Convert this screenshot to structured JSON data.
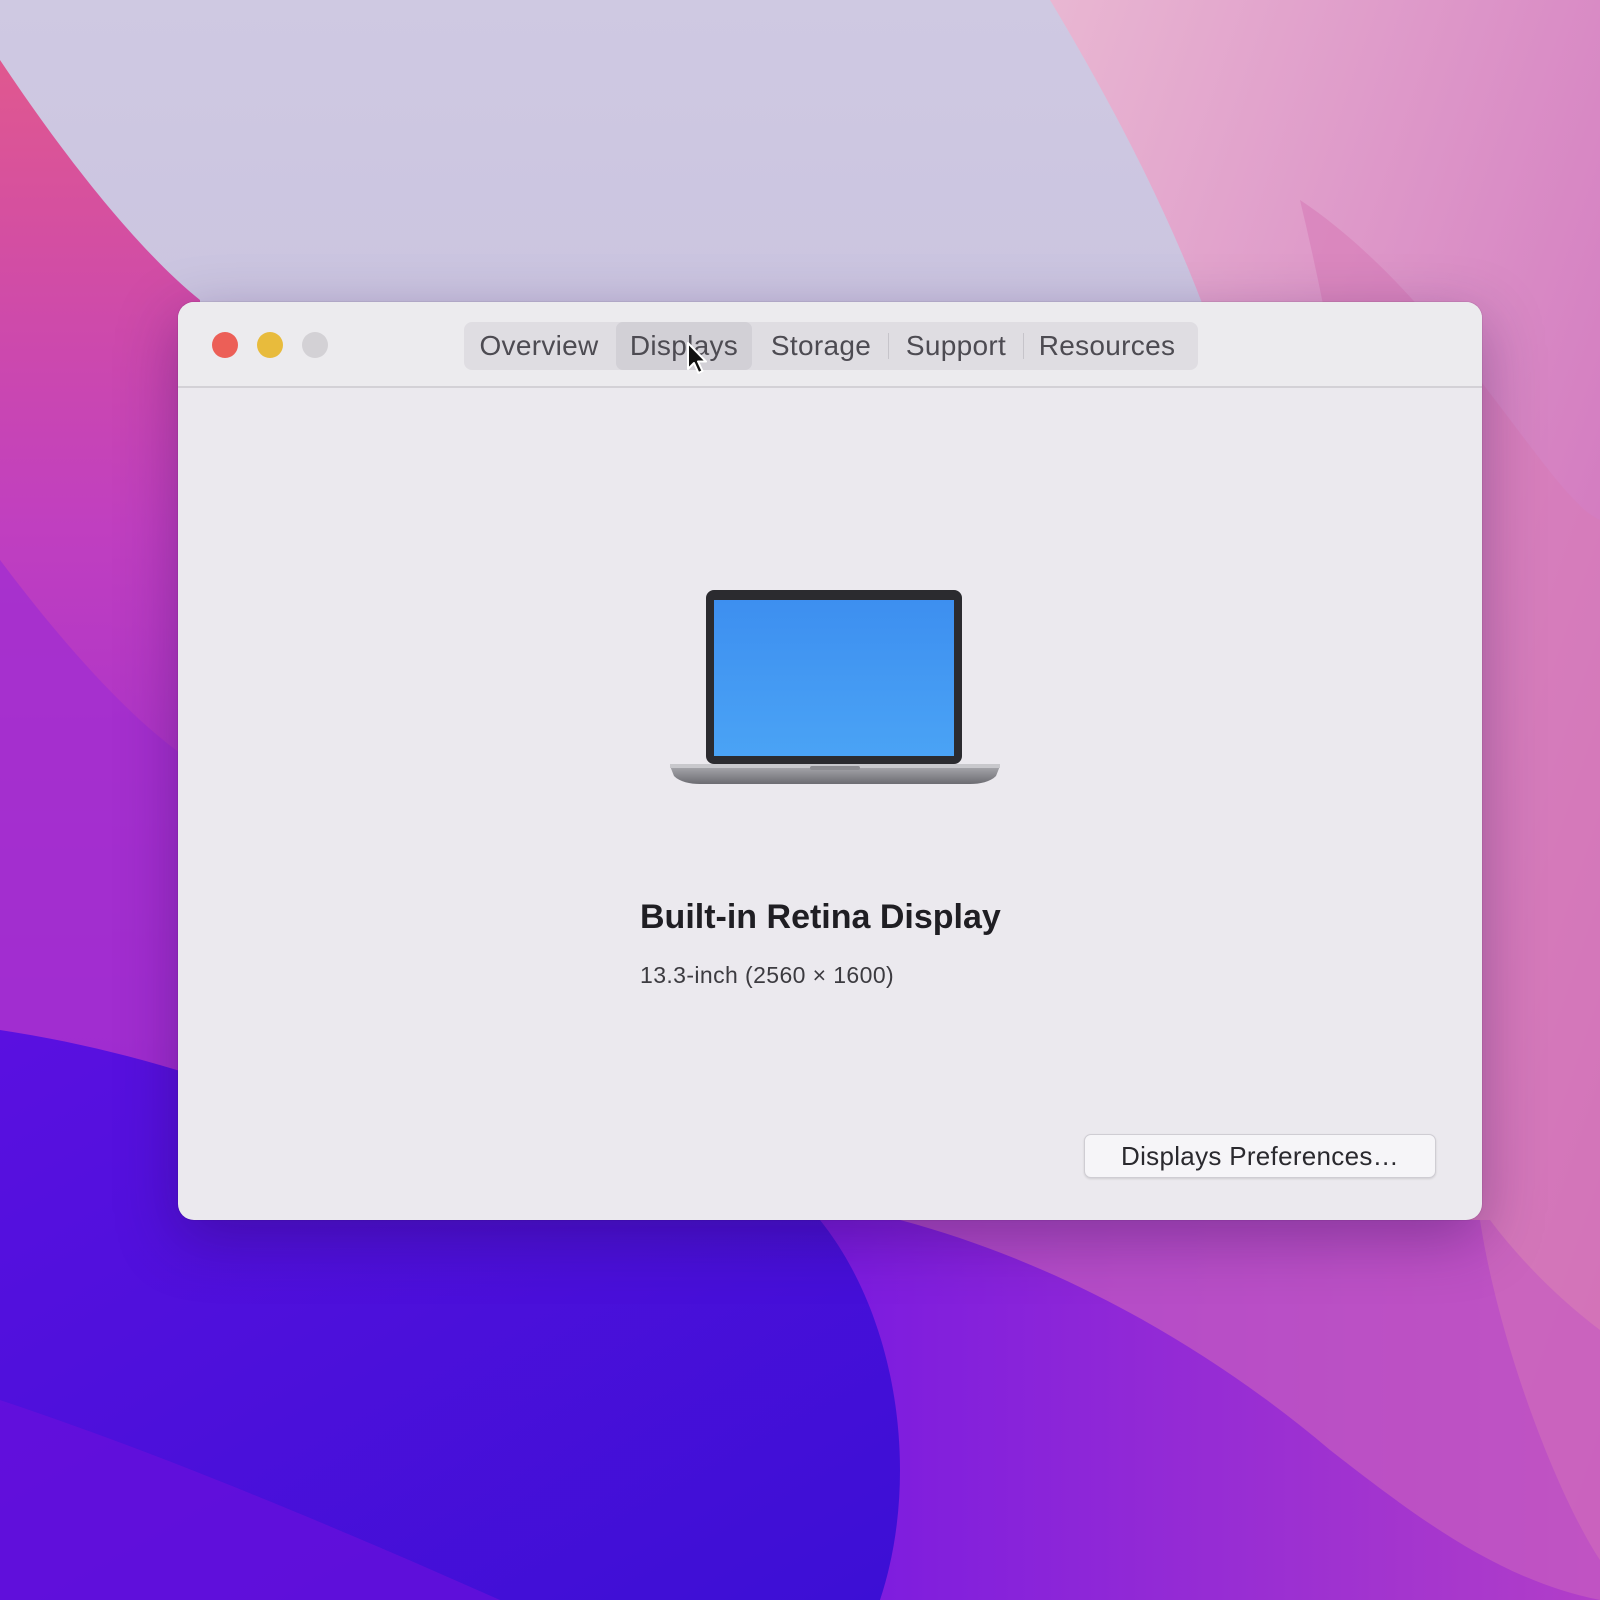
{
  "window": {
    "tabs": [
      {
        "label": "Overview",
        "active": false
      },
      {
        "label": "Displays",
        "active": true
      },
      {
        "label": "Storage",
        "active": false
      },
      {
        "label": "Support",
        "active": false
      },
      {
        "label": "Resources",
        "active": false
      }
    ]
  },
  "display": {
    "name": "Built-in Retina Display",
    "details": "13.3-inch (2560 × 1600)"
  },
  "actions": {
    "preferences_label": "Displays Preferences…"
  },
  "colors": {
    "traffic_close": "#ec5f57",
    "traffic_minimize": "#e8bb3c",
    "traffic_zoom_disabled": "#d3d1d5",
    "screen_blue": "#3d8ff0"
  },
  "icons": {
    "laptop": "laptop-icon",
    "cursor": "mouse-pointer-icon"
  }
}
